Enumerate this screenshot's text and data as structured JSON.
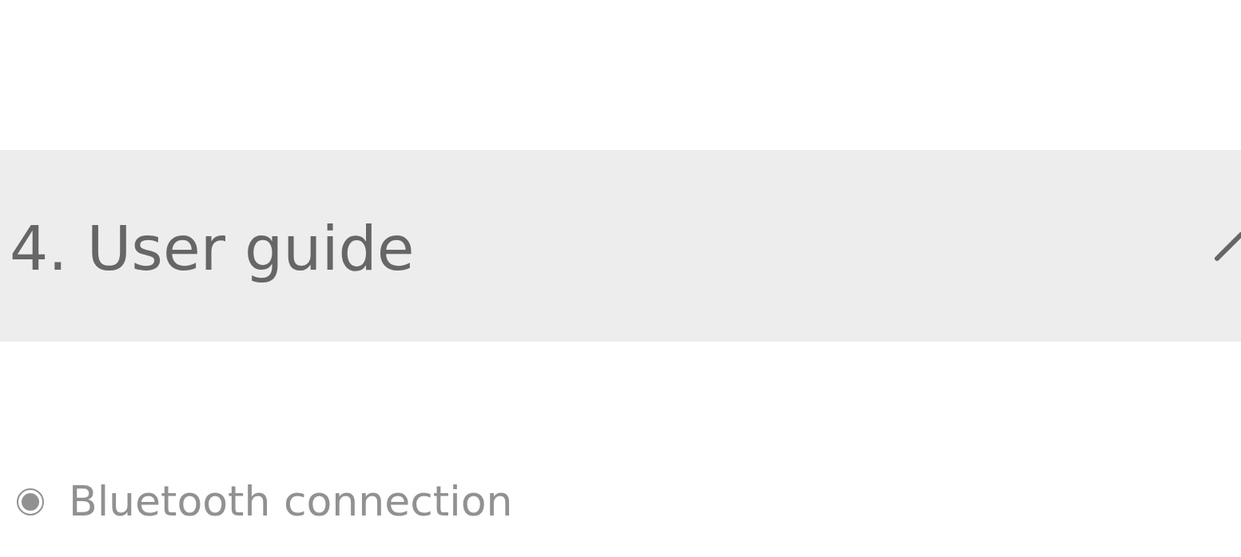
{
  "section": {
    "title": "4. User guide",
    "expanded": true
  },
  "items": [
    {
      "label": "Bluetooth connection",
      "selected": true
    }
  ]
}
